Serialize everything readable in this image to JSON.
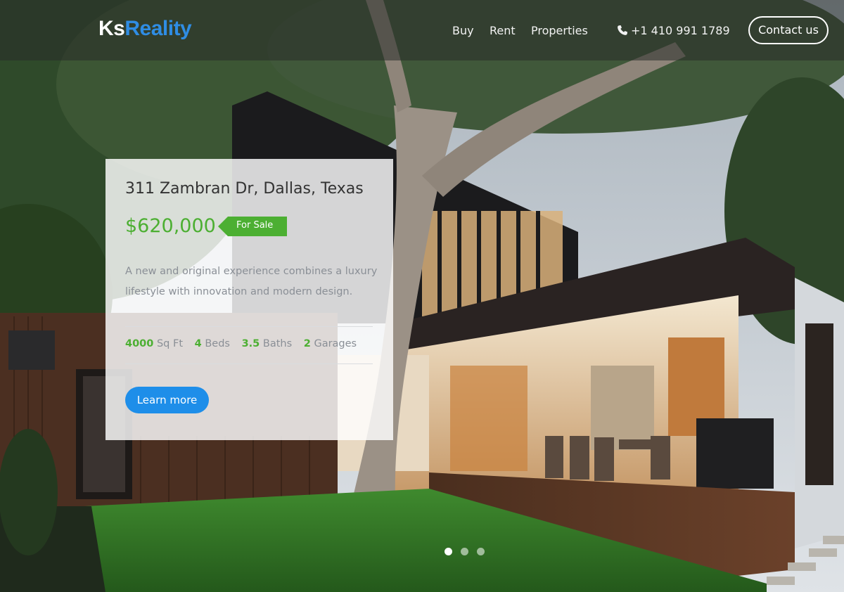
{
  "brand": {
    "part1": "Ks",
    "part2": "Reality"
  },
  "nav": {
    "items": [
      {
        "label": "Buy"
      },
      {
        "label": "Rent"
      },
      {
        "label": "Properties"
      }
    ],
    "phone": "+1 410 991 1789",
    "contact_label": "Contact us"
  },
  "listing": {
    "address": "311 Zambran Dr, Dallas, Texas",
    "price": "$620,000",
    "status": "For Sale",
    "description": "A new and original experience combines a luxury lifestyle with innovation and modern design.",
    "stats": [
      {
        "value": "4000",
        "unit": "Sq Ft"
      },
      {
        "value": "4",
        "unit": "Beds"
      },
      {
        "value": "3.5",
        "unit": "Baths"
      },
      {
        "value": "2",
        "unit": "Garages"
      }
    ],
    "cta_label": "Learn more"
  },
  "carousel": {
    "slide_count": 3,
    "active_index": 0
  },
  "colors": {
    "accent_blue": "#1e8ee9",
    "price_green": "#4caf32",
    "logo_blue": "#2f8de4"
  },
  "icons": {
    "phone": "phone-icon"
  }
}
